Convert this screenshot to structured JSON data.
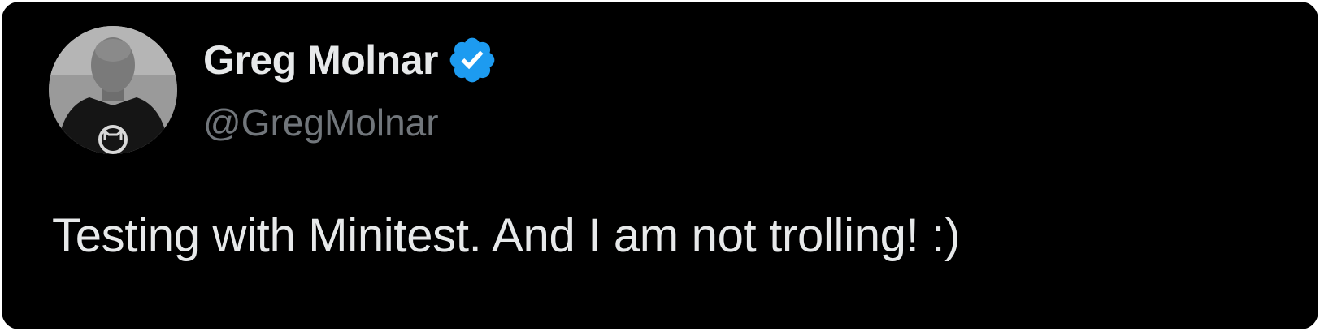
{
  "tweet": {
    "author": {
      "display_name": "Greg Molnar",
      "handle": "@GregMolnar",
      "verified": true,
      "avatar_icon": "profile-photo"
    },
    "text": "Testing with Minitest. And I am not trolling! :)"
  },
  "colors": {
    "background": "#000000",
    "primary_text": "#e7e9ea",
    "secondary_text": "#71767b",
    "verified_badge": "#1d9bf0"
  }
}
